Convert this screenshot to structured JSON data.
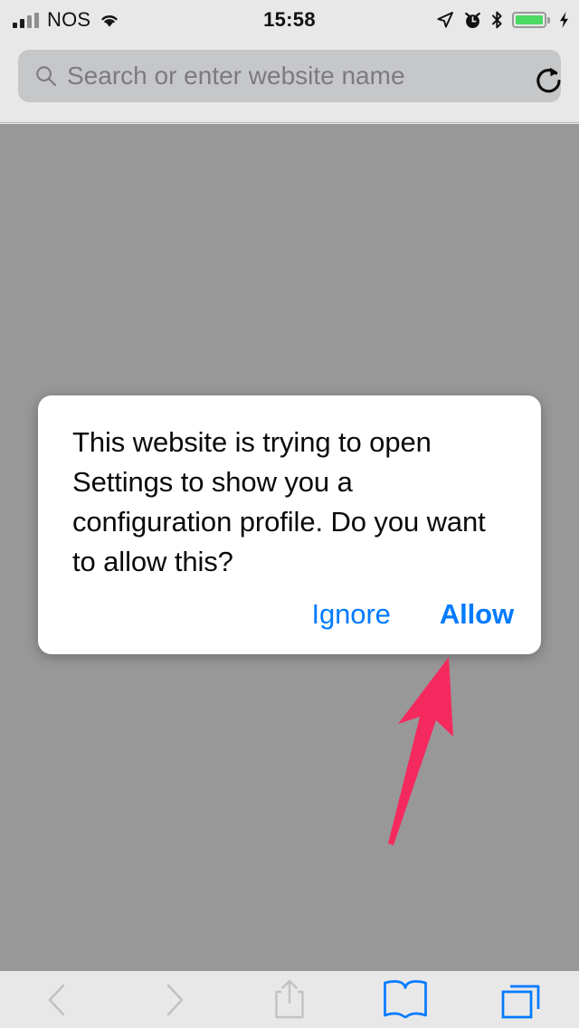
{
  "status_bar": {
    "carrier": "NOS",
    "time": "15:58",
    "signal_bars_filled": 2,
    "signal_bars_total": 4,
    "icons": [
      "wifi-icon",
      "location-arrow-icon",
      "alarm-clock-icon",
      "bluetooth-icon",
      "battery-icon",
      "charging-bolt-icon"
    ],
    "battery_level_percent": 100,
    "battery_color": "#4cd964"
  },
  "browser": {
    "url_placeholder": "Search or enter website name",
    "url_value": "",
    "search_icon": "search-icon",
    "reload_icon": "reload-icon"
  },
  "dialog": {
    "message": "This website is trying to open Settings to show you a configuration profile. Do you want to allow this?",
    "buttons": [
      {
        "label": "Ignore",
        "style": "regular"
      },
      {
        "label": "Allow",
        "style": "bold"
      }
    ],
    "accent_color": "#007aff"
  },
  "annotation": {
    "type": "arrow",
    "color": "#f42a5f",
    "points_at": "Allow"
  },
  "toolbar": {
    "items": [
      {
        "name": "back-button",
        "icon": "chevron-left-icon",
        "enabled": false,
        "color": "#c2c2c2"
      },
      {
        "name": "forward-button",
        "icon": "chevron-right-icon",
        "enabled": false,
        "color": "#c2c2c2"
      },
      {
        "name": "share-button",
        "icon": "share-icon",
        "enabled": false,
        "color": "#c2c2c2"
      },
      {
        "name": "bookmarks-button",
        "icon": "book-icon",
        "enabled": true,
        "color": "#007aff"
      },
      {
        "name": "tabs-button",
        "icon": "tabs-icon",
        "enabled": true,
        "color": "#007aff"
      }
    ]
  },
  "colors": {
    "chrome_background": "#e8e8e8",
    "dimmed_page": "#989899",
    "url_field": "#c6c7c9",
    "accent_blue": "#007aff",
    "annotation_pink": "#f42a5f"
  }
}
